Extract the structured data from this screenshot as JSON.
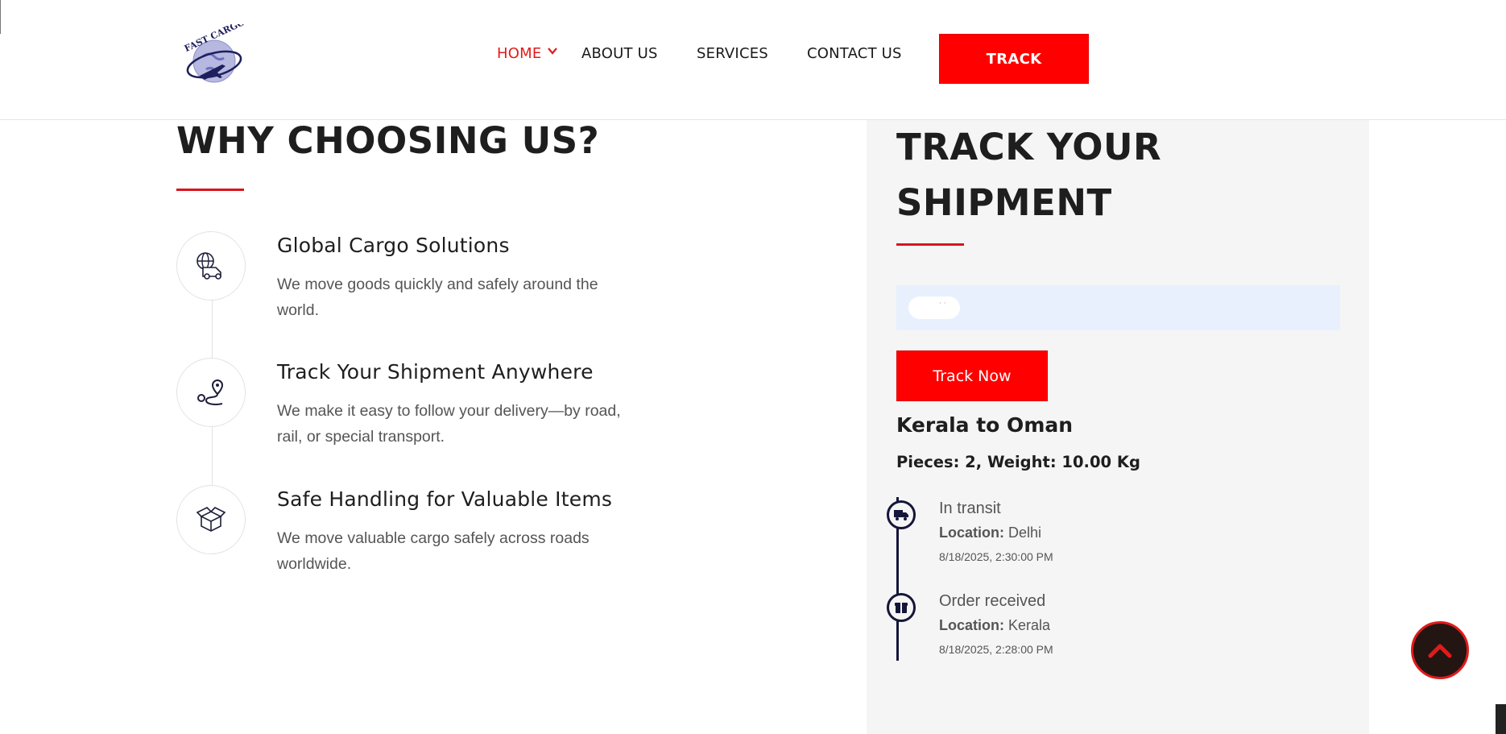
{
  "header": {
    "logo_text": "FAST CARGO",
    "nav": {
      "home": "HOME",
      "about": "ABOUT US",
      "services": "SERVICES",
      "contact": "CONTACT US"
    },
    "track_button": "TRACK"
  },
  "why": {
    "title": "WHY CHOOSING US?",
    "features": [
      {
        "title": "Global Cargo Solutions",
        "desc": "We move goods quickly and safely around the world.",
        "icon": "delivery-globe-icon"
      },
      {
        "title": "Track Your Shipment Anywhere",
        "desc": "We make it easy to follow your delivery—by road, rail, or special transport.",
        "icon": "route-pin-icon"
      },
      {
        "title": "Safe Handling for Valuable Items",
        "desc": "We move valuable cargo safely across roads worldwide.",
        "icon": "open-box-icon"
      }
    ]
  },
  "tracking": {
    "title": "TRACK YOUR SHIPMENT",
    "input_value": "",
    "input_dots": "· ·",
    "button": "Track Now",
    "route": "Kerala to Oman",
    "pieces": "Pieces: 2, Weight: 10.00 Kg",
    "location_label": "Location:",
    "events": [
      {
        "status": "In transit",
        "location": "Delhi",
        "time": "8/18/2025, 2:30:00 PM",
        "icon": "truck-icon"
      },
      {
        "status": "Order received",
        "location": "Kerala",
        "time": "8/18/2025, 2:28:00 PM",
        "icon": "box-icon"
      }
    ]
  },
  "colors": {
    "accent_red": "#ff0000",
    "navy": "#14163a",
    "panel_bg": "#f5f5f5"
  },
  "scroll_top_icon": "chevron-up-icon"
}
